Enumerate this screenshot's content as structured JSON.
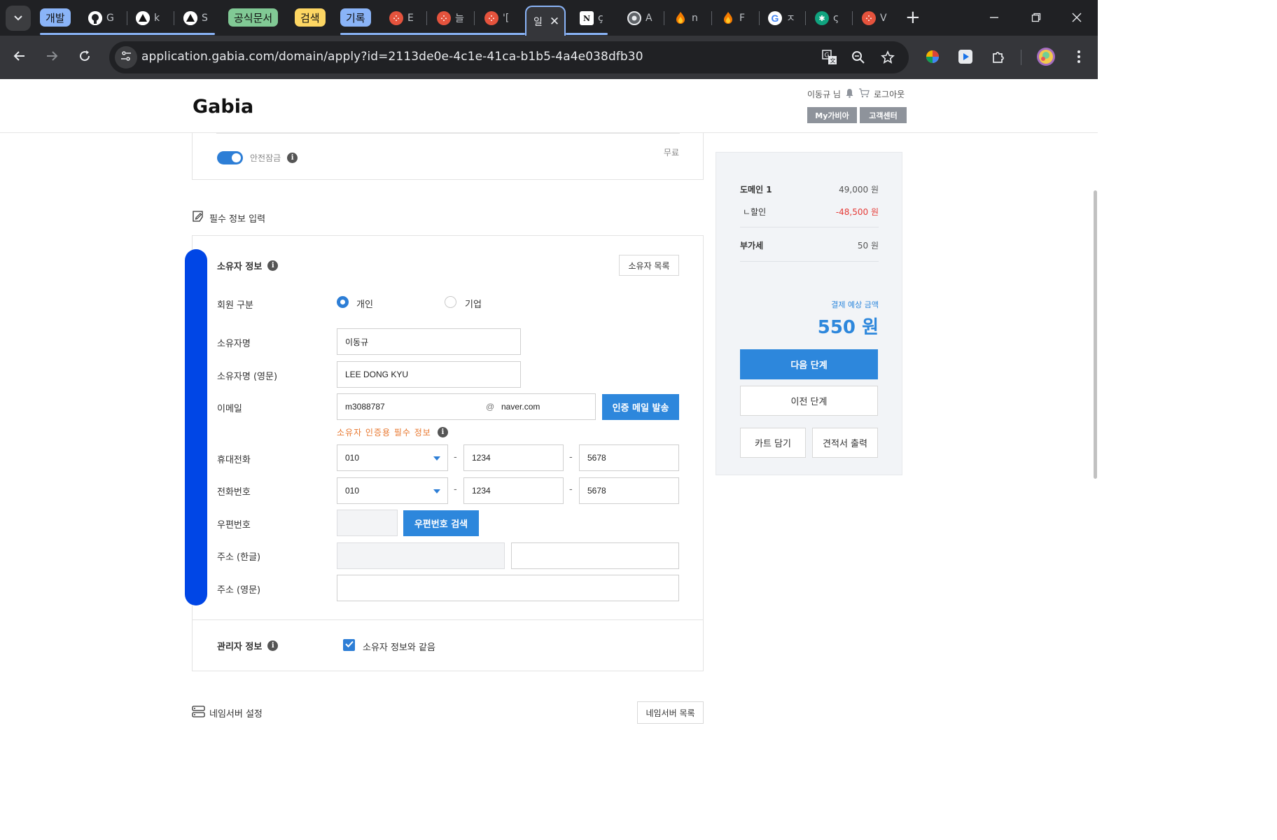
{
  "browser": {
    "tab_groups": [
      {
        "label": "개발",
        "color": "#8ab4f8"
      },
      {
        "label": "공식문서",
        "color": "#81c995"
      },
      {
        "label": "검색",
        "color": "#fdd663"
      },
      {
        "label": "기록",
        "color": "#8ab4f8"
      }
    ],
    "tabs": [
      {
        "title": "G",
        "icon": "github-icon",
        "color": "#202124"
      },
      {
        "title": "k",
        "icon": "vercel-icon",
        "color": "#202124"
      },
      {
        "title": "S",
        "icon": "vercel-icon",
        "color": "#202124"
      },
      {
        "title": "E",
        "icon": "tistory-icon",
        "color": "#e5533d"
      },
      {
        "title": "늘",
        "icon": "tistory-icon",
        "color": "#e5533d"
      },
      {
        "title": "'[",
        "icon": "tistory-icon",
        "color": "#e5533d"
      },
      {
        "title": "ç",
        "icon": "notion-icon",
        "color": "#202124"
      },
      {
        "title": "A",
        "icon": "chrome-icon",
        "color": "#202124"
      },
      {
        "title": "n",
        "icon": "firebase-icon",
        "color": "#f57c00"
      },
      {
        "title": "F",
        "icon": "firebase-icon",
        "color": "#f57c00"
      },
      {
        "title": "ㅈ",
        "icon": "google-icon",
        "color": "#202124"
      },
      {
        "title": "ς",
        "icon": "chatgpt-icon",
        "color": "#10a37f"
      },
      {
        "title": "V",
        "icon": "tistory-icon",
        "color": "#e5533d"
      }
    ],
    "active_tab": {
      "title": "일",
      "close": "✕"
    },
    "url": "application.gabia.com/domain/apply?id=2113de0e-4c1e-41ca-b1b5-4a4e038dfb30"
  },
  "header": {
    "logo": "Gabia",
    "user": "이동규 님",
    "logout": "로그아웃",
    "my_gabia": "My가비아",
    "support": "고객센터"
  },
  "safe_lock": {
    "label": "안전잠금",
    "price": "무료",
    "enabled": true
  },
  "required_section": {
    "title": "필수 정보 입력"
  },
  "owner": {
    "title": "소유자 정보",
    "list_button": "소유자 목록",
    "member_type": {
      "label": "회원 구분",
      "options": [
        "개인",
        "기업"
      ],
      "selected": "개인"
    },
    "name": {
      "label": "소유자명",
      "value": "이동규"
    },
    "name_en": {
      "label": "소유자명 (영문)",
      "value": "LEE DONG KYU"
    },
    "email": {
      "label": "이메일",
      "local": "m3088787",
      "at": "@",
      "domain": "naver.com",
      "send_button": "인증 메일 발송",
      "note": "소유자 인증용 필수 정보"
    },
    "mobile": {
      "label": "휴대전화",
      "prefix": "010",
      "middle": "1234",
      "last": "5678"
    },
    "phone": {
      "label": "전화번호",
      "prefix": "010",
      "middle": "1234",
      "last": "5678"
    },
    "postal": {
      "label": "우편번호",
      "value": "",
      "search_button": "우편번호 검색"
    },
    "address_ko": {
      "label": "주소 (한글)",
      "value": "",
      "detail": ""
    },
    "address_en": {
      "label": "주소 (영문)",
      "value": ""
    },
    "dash": "-"
  },
  "admin": {
    "title": "관리자 정보",
    "same_as_owner": "소유자 정보와 같음",
    "checked": true
  },
  "nameserver": {
    "title": "네임서버 설정",
    "list_button": "네임서버 목록"
  },
  "summary": {
    "domain_label": "도메인 1",
    "domain_price": "49,000 원",
    "discount_label": "ㄴ할인",
    "discount_price": "-48,500 원",
    "vat_label": "부가세",
    "vat_price": "50 원",
    "estimated_label": "결제 예상 금액",
    "estimated_amount": "550 원",
    "next_button": "다음 단계",
    "prev_button": "이전 단계",
    "cart_button": "카트 담기",
    "quote_button": "견적서 출력"
  },
  "colors": {
    "accent": "#2d87dc",
    "discount": "#e53935",
    "note": "#e8772e",
    "highlight": "#0046e6"
  }
}
